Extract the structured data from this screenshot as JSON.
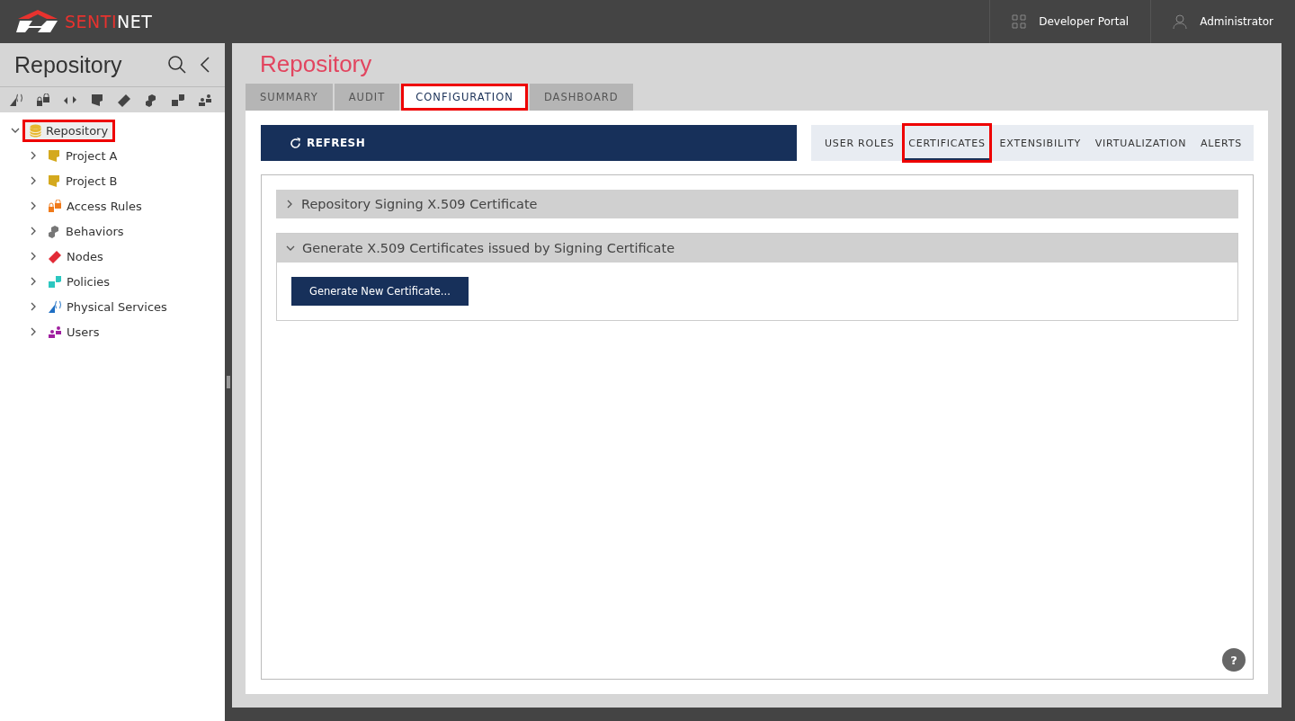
{
  "header": {
    "logo": {
      "part_red": "SENTI",
      "part_white": "NET"
    },
    "links": [
      {
        "kind": "grid",
        "label": "Developer Portal"
      },
      {
        "kind": "user",
        "label": "Administrator"
      }
    ]
  },
  "sidebar": {
    "title": "Repository",
    "toolbar": [
      {
        "kind": "service"
      },
      {
        "kind": "lock"
      },
      {
        "kind": "arrows"
      },
      {
        "kind": "folder"
      },
      {
        "kind": "node"
      },
      {
        "kind": "behavior"
      },
      {
        "kind": "policy"
      },
      {
        "kind": "users"
      }
    ],
    "tree": [
      {
        "label": "Repository",
        "kind": "database",
        "expanded": true,
        "highlighted": true,
        "children": [
          {
            "label": "Project A",
            "kind": "folder",
            "expanded": false,
            "highlighted": false
          },
          {
            "label": "Project B",
            "kind": "folder",
            "expanded": false,
            "highlighted": false
          },
          {
            "label": "Access Rules",
            "kind": "lock",
            "expanded": false,
            "highlighted": false
          },
          {
            "label": "Behaviors",
            "kind": "behavior",
            "expanded": false,
            "highlighted": false
          },
          {
            "label": "Nodes",
            "kind": "node",
            "expanded": false,
            "highlighted": false
          },
          {
            "label": "Policies",
            "kind": "policy",
            "expanded": false,
            "highlighted": false
          },
          {
            "label": "Physical Services",
            "kind": "service",
            "expanded": false,
            "highlighted": false
          },
          {
            "label": "Users",
            "kind": "users",
            "expanded": false,
            "highlighted": false
          }
        ]
      }
    ]
  },
  "main": {
    "title": "Repository",
    "tabs": [
      {
        "label": "SUMMARY",
        "selected": false,
        "highlighted": false
      },
      {
        "label": "AUDIT",
        "selected": false,
        "highlighted": false
      },
      {
        "label": "CONFIGURATION",
        "selected": true,
        "highlighted": true
      },
      {
        "label": "DASHBOARD",
        "selected": false,
        "highlighted": false
      }
    ],
    "refresh_button": "REFRESH",
    "subtabs": [
      {
        "label": "USER ROLES",
        "selected": false,
        "highlighted": false
      },
      {
        "label": "CERTIFICATES",
        "selected": true,
        "highlighted": true
      },
      {
        "label": "EXTENSIBILITY",
        "selected": false,
        "highlighted": false
      },
      {
        "label": "VIRTUALIZATION",
        "selected": false,
        "highlighted": false
      },
      {
        "label": "ALERTS",
        "selected": false,
        "highlighted": false
      }
    ],
    "sections": [
      {
        "title": "Repository Signing X.509 Certificate",
        "expanded": false
      },
      {
        "title": "Generate X.509 Certificates issued by Signing Certificate",
        "expanded": true,
        "button": "Generate New Certificate..."
      }
    ],
    "help_button": "?"
  }
}
